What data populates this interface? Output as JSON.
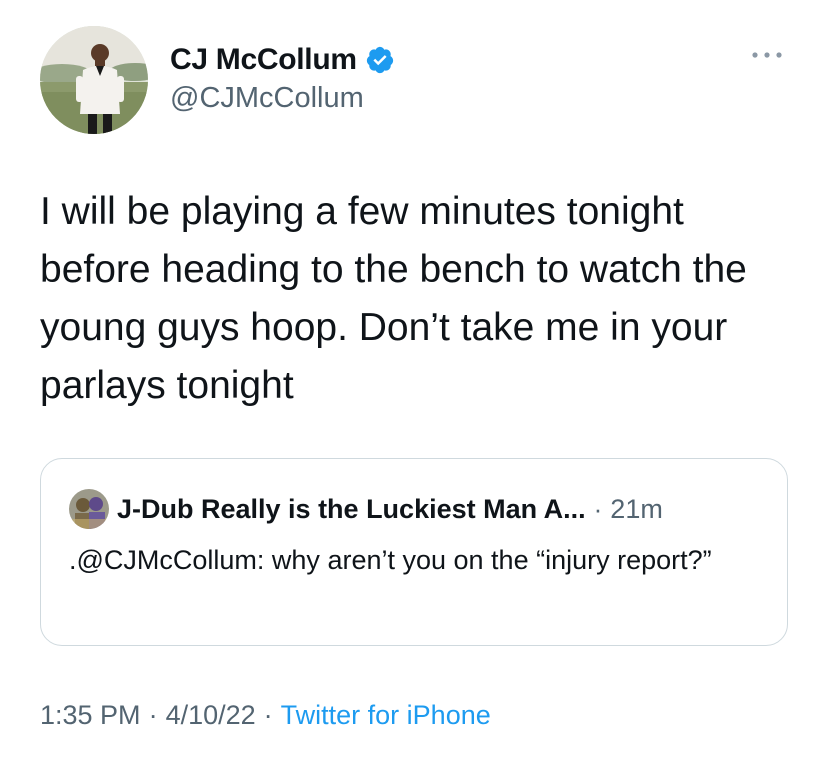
{
  "author": {
    "display_name": "CJ McCollum",
    "handle": "@CJMcCollum",
    "verified_icon": "verified-badge-icon",
    "avatar": "avatar-photo"
  },
  "more_menu_icon": "more-options-icon",
  "tweet": {
    "text": "I will be playing a few minutes tonight before heading to the bench to watch the young guys hoop. Don’t take me in your parlays tonight"
  },
  "quoted_tweet": {
    "display_name": "J-Dub Really is the Luckiest Man A...",
    "separator": "·",
    "time_ago": "21m",
    "text": ".@CJMcCollum: why aren’t you on the “injury report?”"
  },
  "meta": {
    "time": "1:35 PM",
    "separator": "·",
    "date": "4/10/22",
    "source": "Twitter for iPhone"
  },
  "colors": {
    "verified": "#1d9bf0",
    "link": "#1d9bf0",
    "secondary_text": "#536471",
    "border": "#cfd9de"
  }
}
